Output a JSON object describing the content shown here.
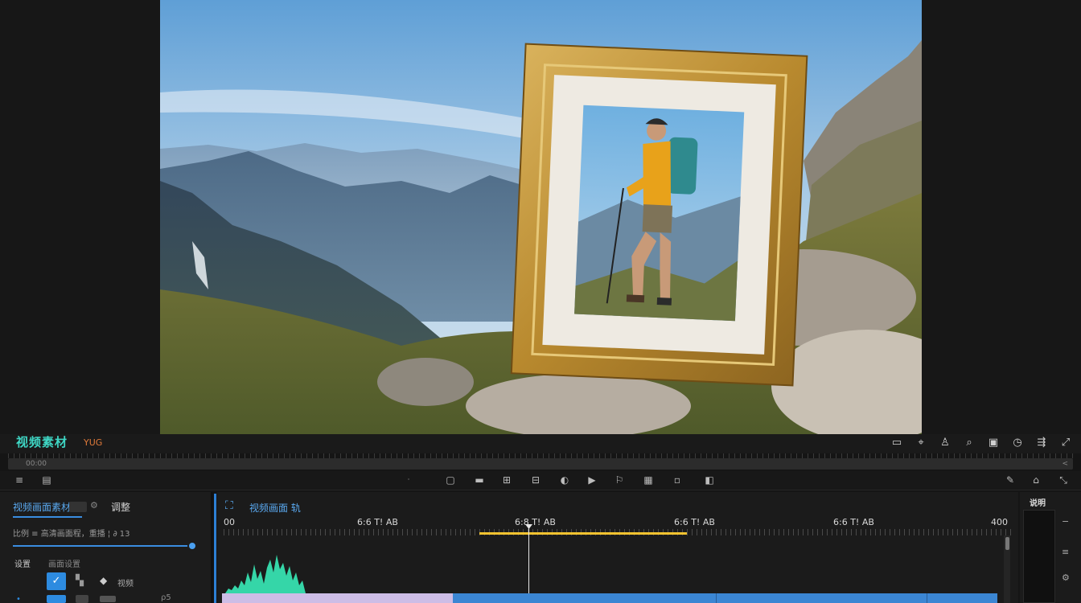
{
  "app": {
    "title": "视频素材",
    "subtitle": "YUG"
  },
  "header_icons": [
    "screen-icon",
    "cursor-icon",
    "person-icon",
    "search-icon",
    "camera-icon",
    "clock-icon",
    "share-icon",
    "expand-icon"
  ],
  "scroll": {
    "label": "00:00",
    "end": "<"
  },
  "left_panel": {
    "tab_active": "视频画面素材",
    "tab_other": "调整",
    "description": "比例 ≡ 高清画面程，重播 ¦ ∂ 13",
    "section_label": "设置",
    "section_sub": "画面设置",
    "item_label": "视频",
    "row2_value": "ρ5"
  },
  "timeline": {
    "title": "视频画面 轨",
    "times": [
      "00",
      "6:6 T! AB",
      "6:8 T! AB",
      "6:6 T! AB",
      "6:6 T! AB",
      "400"
    ],
    "range_start_pct": 0.33,
    "range_end_pct": 0.59,
    "playhead_pct": 0.39
  },
  "right_panel": {
    "title": "说明"
  },
  "colors": {
    "accent": "#3a8de0",
    "brand": "#3fd7c5",
    "range": "#f2c230",
    "clip_a": "#cdbde6",
    "clip_b": "#3b86d3"
  }
}
